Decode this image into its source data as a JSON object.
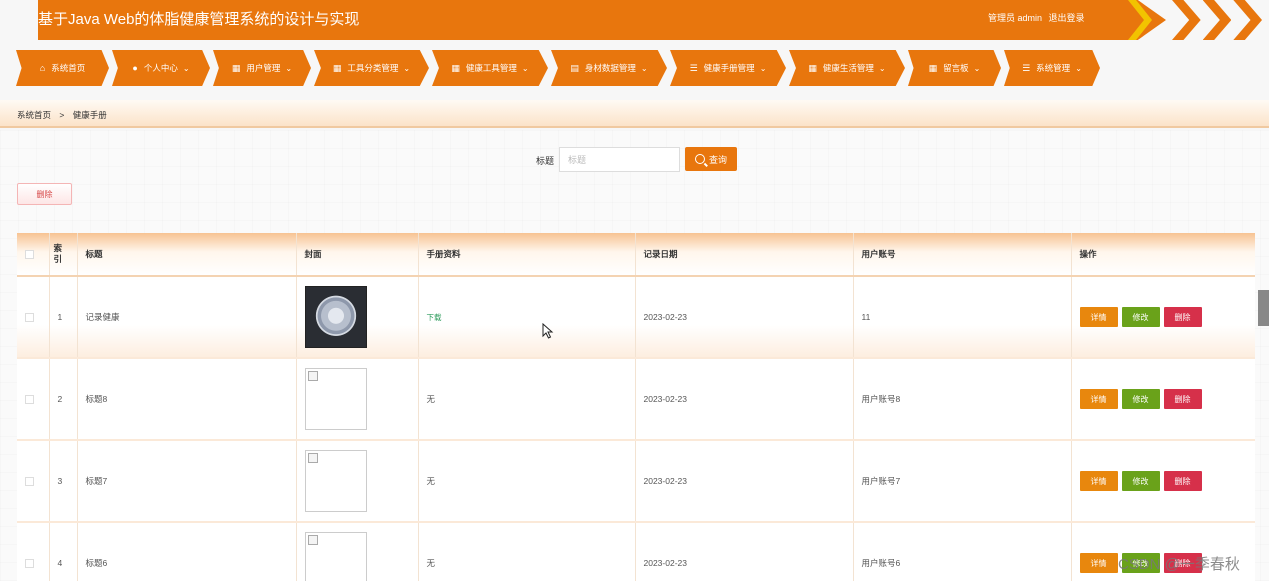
{
  "header": {
    "title": "基于Java Web的体脂健康管理系统的设计与实现",
    "user_label": "管理员 admin",
    "logout": "退出登录"
  },
  "nav": {
    "items": [
      {
        "label": "系统首页",
        "icon": "home-icon",
        "glyph": "⌂"
      },
      {
        "label": "个人中心",
        "icon": "person-icon",
        "glyph": "●"
      },
      {
        "label": "用户管理",
        "icon": "grid-icon",
        "glyph": "▦"
      },
      {
        "label": "工具分类管理",
        "icon": "grid-icon",
        "glyph": "▦"
      },
      {
        "label": "健康工具管理",
        "icon": "grid-icon",
        "glyph": "▦"
      },
      {
        "label": "身材数据管理",
        "icon": "table-icon",
        "glyph": "▤"
      },
      {
        "label": "健康手册管理",
        "icon": "list-icon",
        "glyph": "☰"
      },
      {
        "label": "健康生活管理",
        "icon": "grid-icon",
        "glyph": "▦"
      },
      {
        "label": "留言板",
        "icon": "grid-icon",
        "glyph": "▦"
      },
      {
        "label": "系统管理",
        "icon": "list-icon",
        "glyph": "☰"
      }
    ]
  },
  "breadcrumb": {
    "home": "系统首页",
    "separator": ">",
    "current": "健康手册"
  },
  "search": {
    "label": "标题",
    "placeholder": "标题",
    "button": "查询"
  },
  "actions": {
    "batch_delete": "删除"
  },
  "table": {
    "columns": [
      "索引",
      "标题",
      "封面",
      "手册资料",
      "记录日期",
      "用户账号",
      "操作"
    ],
    "index_header_lines": [
      "索",
      "引"
    ],
    "rows": [
      {
        "index": "1",
        "title": "记录健康",
        "cover": "photo",
        "material": "下载",
        "date": "2023-02-23",
        "account": "11"
      },
      {
        "index": "2",
        "title": "标题8",
        "cover": "broken",
        "material": "无",
        "date": "2023-02-23",
        "account": "用户账号8"
      },
      {
        "index": "3",
        "title": "标题7",
        "cover": "broken",
        "material": "无",
        "date": "2023-02-23",
        "account": "用户账号7"
      },
      {
        "index": "4",
        "title": "标题6",
        "cover": "broken",
        "material": "无",
        "date": "2023-02-23",
        "account": "用户账号6"
      }
    ],
    "row_actions": {
      "detail": "详情",
      "edit": "修改",
      "delete": "删除"
    }
  },
  "watermark": "CSDN @一季春秋",
  "colors": {
    "primary": "#e8760d",
    "accent_stripe": "#f2c300",
    "edit": "#6aa21a",
    "delete": "#d6304a",
    "download": "#2e9c5c"
  }
}
